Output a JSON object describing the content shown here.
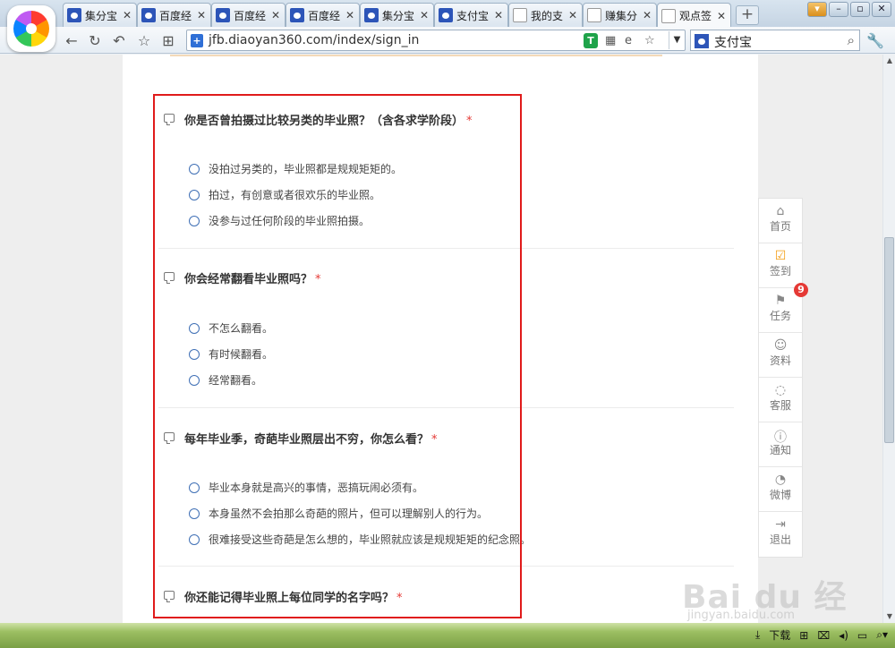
{
  "tabs": [
    {
      "title": "集分宝",
      "icon": "paw"
    },
    {
      "title": "百度经",
      "icon": "paw"
    },
    {
      "title": "百度经",
      "icon": "paw"
    },
    {
      "title": "百度经",
      "icon": "paw"
    },
    {
      "title": "集分宝",
      "icon": "paw"
    },
    {
      "title": "支付宝",
      "icon": "paw"
    },
    {
      "title": "我的支",
      "icon": "doc"
    },
    {
      "title": "赚集分",
      "icon": "doc"
    },
    {
      "title": "观点签",
      "icon": "doc",
      "active": true
    }
  ],
  "tab_close": "✕",
  "new_tab": "+",
  "address": {
    "url": "jfb.diaoyan360.com/index/sign_in"
  },
  "search": {
    "text": "支付宝"
  },
  "questions": [
    {
      "title": "你是否曾拍摄过比较另类的毕业照？（含各求学阶段）",
      "required_mark": "*",
      "options": [
        "没拍过另类的，毕业照都是规规矩矩的。",
        "拍过，有创意或者很欢乐的毕业照。",
        "没参与过任何阶段的毕业照拍摄。"
      ]
    },
    {
      "title": "你会经常翻看毕业照吗？",
      "required_mark": "*",
      "options": [
        "不怎么翻看。",
        "有时候翻看。",
        "经常翻看。"
      ]
    },
    {
      "title": "每年毕业季，奇葩毕业照层出不穷，你怎么看？",
      "required_mark": "*",
      "options": [
        "毕业本身就是高兴的事情，恶搞玩闹必须有。",
        "本身虽然不会拍那么奇葩的照片，但可以理解别人的行为。",
        "很难接受这些奇葩是怎么想的，毕业照就应该是规规矩矩的纪念照。"
      ]
    },
    {
      "title": "你还能记得毕业照上每位同学的名字吗？",
      "required_mark": "*",
      "options": []
    }
  ],
  "dock": [
    {
      "label": "首页",
      "icon": "home-icon"
    },
    {
      "label": "签到",
      "icon": "checkin-icon"
    },
    {
      "label": "任务",
      "icon": "flag-icon",
      "badge": "9"
    },
    {
      "label": "资料",
      "icon": "user-icon"
    },
    {
      "label": "客服",
      "icon": "chat-icon"
    },
    {
      "label": "通知",
      "icon": "alert-icon"
    },
    {
      "label": "微博",
      "icon": "weibo-icon"
    },
    {
      "label": "退出",
      "icon": "logout-icon"
    }
  ],
  "status": {
    "download_label": "下载"
  },
  "watermark": {
    "text": "Bai du 经验",
    "sub": "jingyan.baidu.com"
  },
  "colors": {
    "highlight": "#e01b1b",
    "required": "#e53935",
    "radio": "#3f6fb5"
  }
}
